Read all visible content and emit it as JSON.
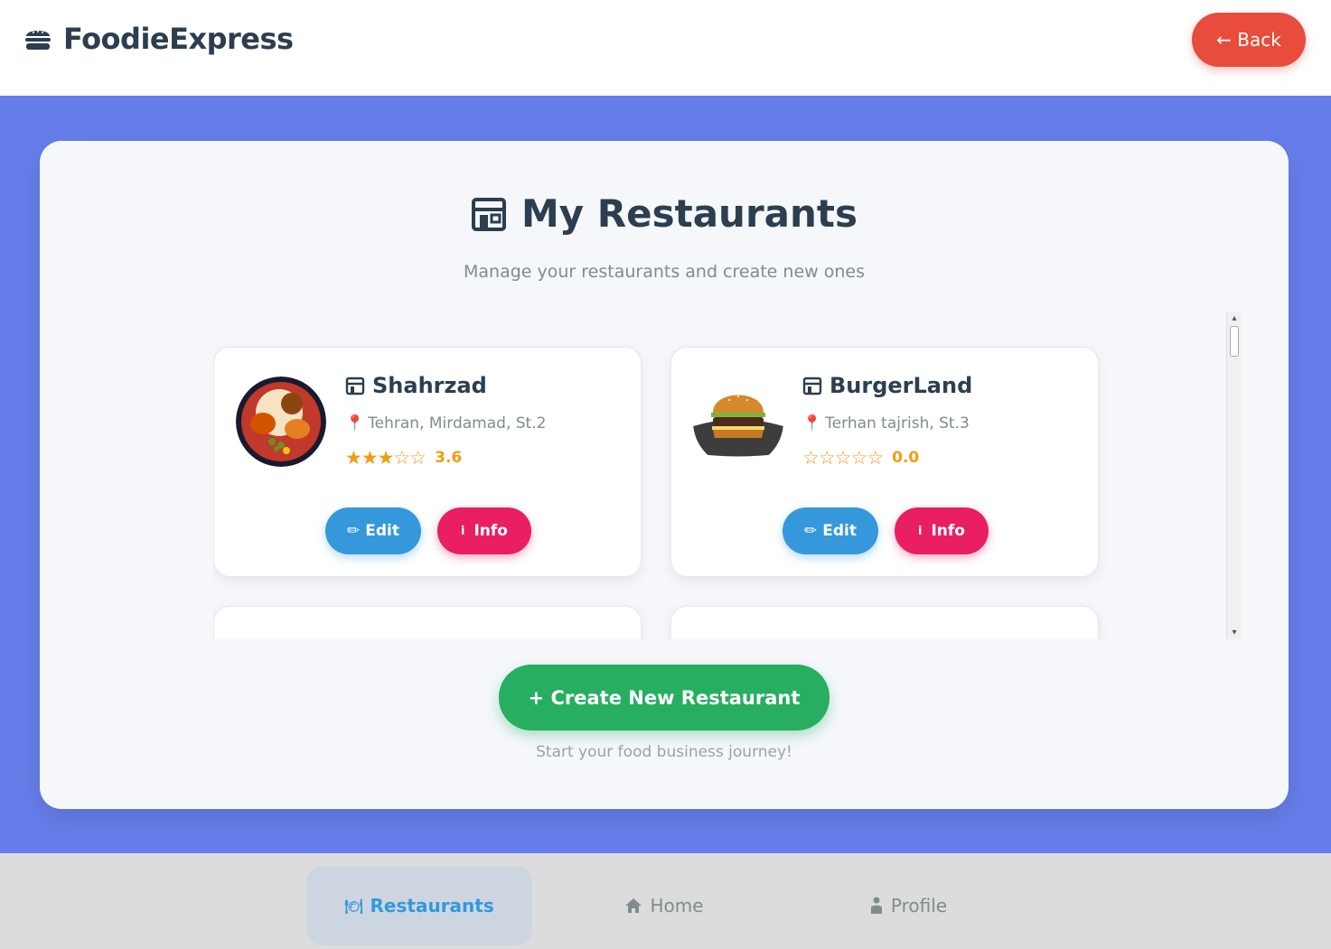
{
  "header": {
    "brand": "FoodieExpress",
    "brand_icon": "burger-icon",
    "back_label": "← Back"
  },
  "page": {
    "title": "My Restaurants",
    "subtitle": "Manage your restaurants and create new ones"
  },
  "restaurants": [
    {
      "name": "Shahrzad",
      "address": "Tehran, Mirdamad, St.2",
      "stars": "★★★☆☆",
      "rating": "3.6",
      "edit": "Edit",
      "info": "Info"
    },
    {
      "name": "BurgerLand",
      "address": "Terhan tajrish, St.3",
      "stars": "☆☆☆☆☆",
      "rating": "0.0",
      "edit": "Edit",
      "info": "Info"
    }
  ],
  "create": {
    "label": "+ Create New Restaurant",
    "hint": "Start your food business journey!"
  },
  "nav": {
    "restaurants": "Restaurants",
    "home": "Home",
    "profile": "Profile"
  },
  "colors": {
    "bg": "#667eea",
    "back": "#e74c3c",
    "edit": "#3498db",
    "info": "#e91e63",
    "create": "#27ae60",
    "star": "#f39c12"
  }
}
